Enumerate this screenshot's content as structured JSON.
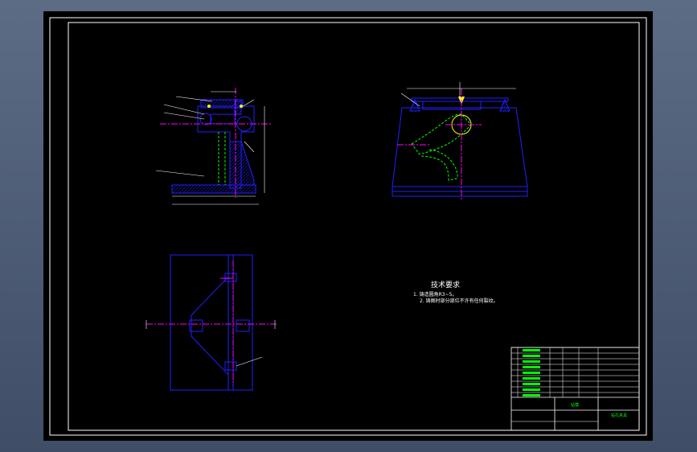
{
  "drawing": {
    "notes": {
      "title": "技术要求",
      "lines": [
        "1. 铸造圆角R3~5。",
        "2. 铸图时部分部位不许有任何裂纹。"
      ]
    },
    "title_block": {
      "part_name": "钻模",
      "drawing_no": "钻孔夹具"
    },
    "colors": {
      "background": "#000000",
      "frame": "#ffffff",
      "outline": "#2020ff",
      "centerline": "#ff00ff",
      "hidden": "#00ff00",
      "hatch": "#2020ff",
      "dimension": "#ffffff",
      "highlight": "#ffff00",
      "table_text": "#00ff00"
    }
  }
}
